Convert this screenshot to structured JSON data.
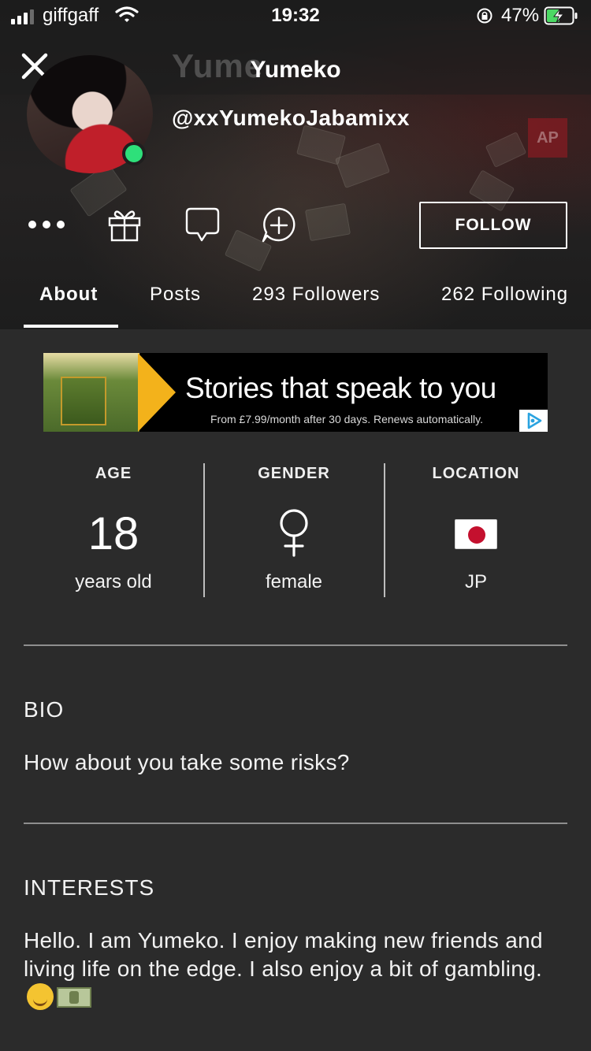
{
  "status_bar": {
    "carrier": "giffgaff",
    "time": "19:32",
    "battery_percent": "47%",
    "signal_bars": 4,
    "signal_bars_filled": 3
  },
  "header": {
    "ghost_name": "Yume",
    "title": "Yumeko",
    "handle": "@xxYumekoJabamixx",
    "badge": "AP",
    "online": true
  },
  "actions": {
    "follow_label": "FOLLOW"
  },
  "tabs": [
    {
      "label": "About",
      "active": true
    },
    {
      "label": "Posts"
    },
    {
      "label": "293 Followers"
    },
    {
      "label": "262 Following"
    }
  ],
  "ad": {
    "headline": "Stories that speak to you",
    "fineprint": "From £7.99/month after 30 days. Renews automatically.",
    "accent_color": "#f3b21b"
  },
  "stats": {
    "age": {
      "label": "AGE",
      "value": "18",
      "sub": "years old"
    },
    "gender": {
      "label": "GENDER",
      "icon": "female-symbol-icon",
      "sub": "female"
    },
    "location": {
      "label": "LOCATION",
      "icon": "japan-flag-icon",
      "sub": "JP"
    }
  },
  "bio": {
    "title": "BIO",
    "text": "How about you take some risks?"
  },
  "interests": {
    "title": "INTERESTS",
    "text": "Hello. I am Yumeko. I enjoy making new friends and living life on the edge. I also enjoy a bit of gambling.",
    "emojis": [
      "smiling-face-emoji",
      "money-bill-emoji"
    ]
  },
  "colors": {
    "background": "#2b2b2b",
    "online_dot": "#2ee07a",
    "divider": "#8e8e8e"
  }
}
